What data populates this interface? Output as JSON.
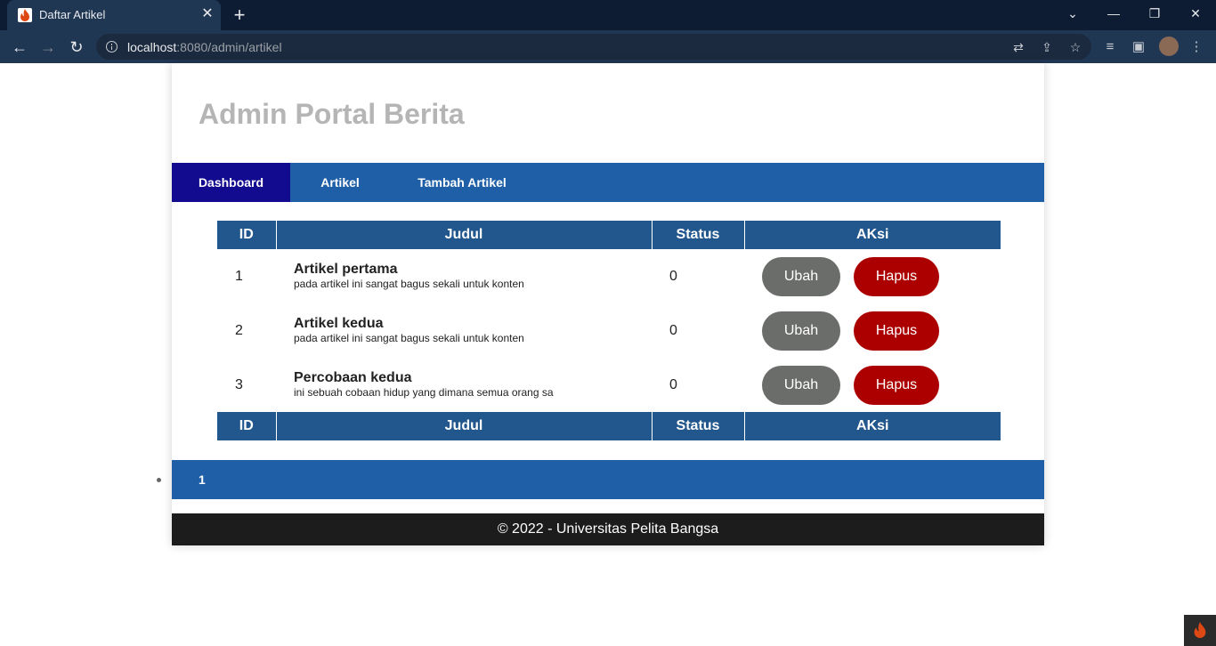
{
  "browser": {
    "tab_title": "Daftar Artikel",
    "tab_close": "✕",
    "new_tab": "+",
    "url_host": "localhost",
    "url_rest": ":8080/admin/artikel",
    "window_controls": {
      "dropdown": "⌄",
      "minimize": "—",
      "restore": "❐",
      "close": "✕"
    },
    "nav": {
      "back": "←",
      "forward": "→",
      "reload": "↻"
    },
    "icons": [
      "translate-icon",
      "share-icon",
      "star-icon",
      "playlist-icon",
      "sidepanel-icon",
      "profile-avatar",
      "menu-icon"
    ]
  },
  "site": {
    "title": "Admin Portal Berita"
  },
  "navbar": {
    "items": [
      {
        "label": "Dashboard",
        "active": true
      },
      {
        "label": "Artikel",
        "active": false
      },
      {
        "label": "Tambah Artikel",
        "active": false
      }
    ]
  },
  "table": {
    "headers": [
      "ID",
      "Judul",
      "Status",
      "AKsi"
    ],
    "footer_headers": [
      "ID",
      "Judul",
      "Status",
      "AKsi"
    ],
    "rows": [
      {
        "id": "1",
        "title": "Artikel pertama",
        "desc": "pada artikel ini sangat bagus sekali untuk konten",
        "status": "0",
        "edit": "Ubah",
        "delete": "Hapus"
      },
      {
        "id": "2",
        "title": "Artikel kedua",
        "desc": "pada artikel ini sangat bagus sekali untuk konten",
        "status": "0",
        "edit": "Ubah",
        "delete": "Hapus"
      },
      {
        "id": "3",
        "title": "Percobaan kedua",
        "desc": "ini sebuah cobaan hidup yang dimana semua orang sa",
        "status": "0",
        "edit": "Ubah",
        "delete": "Hapus"
      }
    ]
  },
  "pagination": {
    "current": "1"
  },
  "footer": {
    "text": "© 2022 - Universitas Pelita Bangsa"
  },
  "colors": {
    "nav_bar": "#1f5fa8",
    "nav_active": "#120a8f",
    "table_header": "#22578e",
    "btn_edit": "#6b6d6a",
    "btn_delete": "#ac0000",
    "footer": "#1c1c1c",
    "title": "#b5b5b5"
  }
}
